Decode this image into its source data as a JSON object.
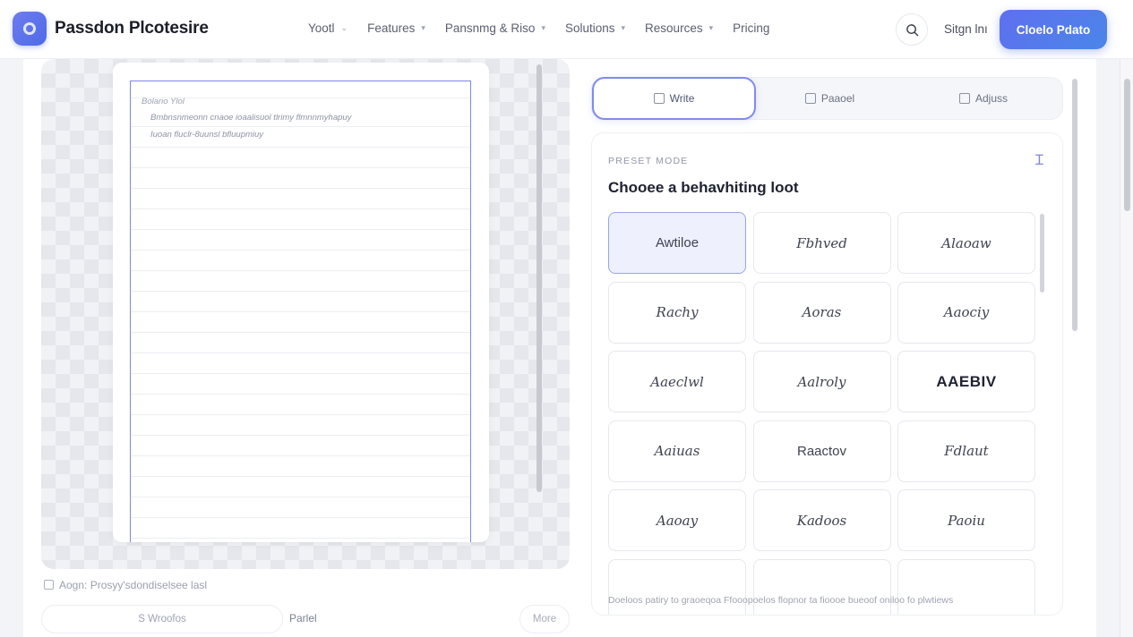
{
  "header": {
    "brand": "Passdon Plcotesire",
    "nav": [
      {
        "label": "Yootl",
        "chevron": true
      },
      {
        "label": "Features",
        "chevron": true
      },
      {
        "label": "Pansnmg & Riso",
        "chevron": true
      },
      {
        "label": "Solutions",
        "chevron": true
      },
      {
        "label": "Resources",
        "chevron": true
      },
      {
        "label": "Pricing",
        "chevron": false
      }
    ],
    "signin_label": "Sitgn lnı",
    "cta_label": "Cloelo Pdato"
  },
  "canvas": {
    "paper_header": "Bolano Ylol",
    "line1": "Bmbnsnmeonn cnaoe ioaalisuol tlrimy flmnnmyhapuy",
    "line2": "Iuoan fluclr-8uunsl bfluupmiuy",
    "note": "Aogn: Prosyy'sdondiselsee lasl",
    "input_label": "S Wroofos",
    "panel_label": "Parlel",
    "more_label": "More"
  },
  "tabs": [
    {
      "label": "Write",
      "active": true
    },
    {
      "label": "Paaoel",
      "active": false
    },
    {
      "label": "Adjuss",
      "active": false
    }
  ],
  "picker": {
    "kicker": "PRESET MODE",
    "title": "Chooee a behavhiting loot",
    "fonts": [
      {
        "label": "Awtiloe",
        "selected": true,
        "style": "sans"
      },
      {
        "label": "Fbhved",
        "selected": false,
        "style": "script"
      },
      {
        "label": "Alaoaw",
        "selected": false,
        "style": "script"
      },
      {
        "label": "Rachy",
        "selected": false,
        "style": "script"
      },
      {
        "label": "Aoras",
        "selected": false,
        "style": "script"
      },
      {
        "label": "Aaociy",
        "selected": false,
        "style": "script"
      },
      {
        "label": "Aaeclwl",
        "selected": false,
        "style": "script"
      },
      {
        "label": "Aalroly",
        "selected": false,
        "style": "script"
      },
      {
        "label": "AAEBIV",
        "selected": false,
        "style": "bold"
      },
      {
        "label": "Aaiuas",
        "selected": false,
        "style": "script"
      },
      {
        "label": "Raactov",
        "selected": false,
        "style": "sans"
      },
      {
        "label": "Fdlaut",
        "selected": false,
        "style": "script"
      },
      {
        "label": "Aaoay",
        "selected": false,
        "style": "script"
      },
      {
        "label": "Kadoos",
        "selected": false,
        "style": "script"
      },
      {
        "label": "Paoiu",
        "selected": false,
        "style": "script"
      },
      {
        "label": "",
        "selected": false,
        "style": "script"
      },
      {
        "label": "",
        "selected": false,
        "style": "script"
      },
      {
        "label": "",
        "selected": false,
        "style": "script"
      }
    ],
    "footer": "Doeloos patiry to graoeqoa Ffooopoelos flopnor ta fioooe bueoof oniloo fo plwtiews"
  },
  "colors": {
    "accent": "#5f6ff0",
    "selected_bg": "#eef0fd",
    "paper_border": "#7e86e6"
  }
}
